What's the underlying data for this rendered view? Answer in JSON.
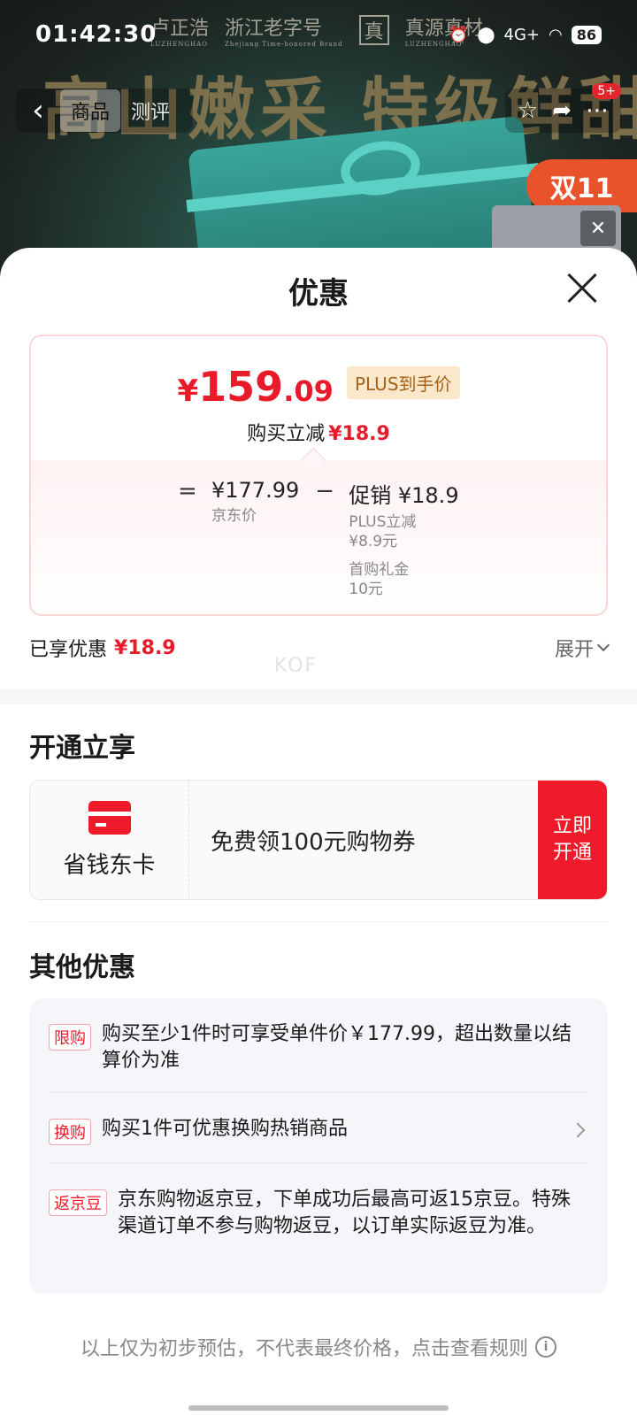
{
  "status_bar": {
    "time": "01:42:30",
    "network": "4G+",
    "battery": "86"
  },
  "background": {
    "brand_1": "卢正浩",
    "brand_1_sub": "LUZHENGHAO",
    "brand_2": "浙江老字号",
    "brand_2_sub": "Zhejiang Time-honored Brand",
    "brand_3": "真源真材",
    "brand_3_sub": "LUZHENGHAO",
    "brand_3_glyph": "真",
    "slogan": "高山嫩采 特级鲜甜",
    "promo_badge": "双11",
    "notification_count": "5+"
  },
  "nav": {
    "tabs": [
      "商品",
      "测评"
    ],
    "active_tab": 0
  },
  "sheet": {
    "title": "优惠",
    "price": {
      "symbol": "¥",
      "integer": "159",
      "decimal": ".09",
      "plus_tag": "PLUS到手价",
      "instant_label": "购买立减",
      "instant_value": "¥18.9"
    },
    "breakdown": {
      "equals": "=",
      "minus": "−",
      "jd_price": "¥177.99",
      "jd_price_label": "京东价",
      "promo_amount": "促销 ¥18.9",
      "promo_items": [
        {
          "label": "PLUS立减",
          "value": "¥8.9元"
        },
        {
          "label": "首购礼金",
          "value": "10元"
        }
      ]
    },
    "enjoyed": {
      "label": "已享优惠",
      "value": "¥18.9",
      "expand": "展开"
    },
    "watermark": "KOF",
    "open_section": {
      "title": "开通立享",
      "card_name": "省钱东卡",
      "offer": "免费领100元购物券",
      "cta": "立即开通"
    },
    "other_section": {
      "title": "其他优惠",
      "offers": [
        {
          "tag": "限购",
          "text": "购买至少1件时可享受单件价￥177.99，超出数量以结算价为准",
          "arrow": false
        },
        {
          "tag": "换购",
          "text": "购买1件可优惠换购热销商品",
          "arrow": true
        },
        {
          "tag": "返京豆",
          "text": "京东购物返京豆，下单成功后最高可返15京豆。特殊渠道订单不参与购物返豆，以订单实际返豆为准。",
          "arrow": false
        }
      ]
    },
    "footer_note": "以上仅为初步预估，不代表最终价格，点击查看规则"
  },
  "colors": {
    "accent_red": "#e91b2a",
    "plus_gold_bg": "#fbe7c9",
    "plus_gold_text": "#a4631a"
  },
  "icons": [
    "back-icon",
    "star-icon",
    "share-icon",
    "more-icon",
    "close-icon",
    "chevron-down-icon",
    "chevron-right-icon",
    "card-icon",
    "info-icon",
    "alarm-icon",
    "location-icon",
    "signal-icon",
    "wifi-icon"
  ]
}
